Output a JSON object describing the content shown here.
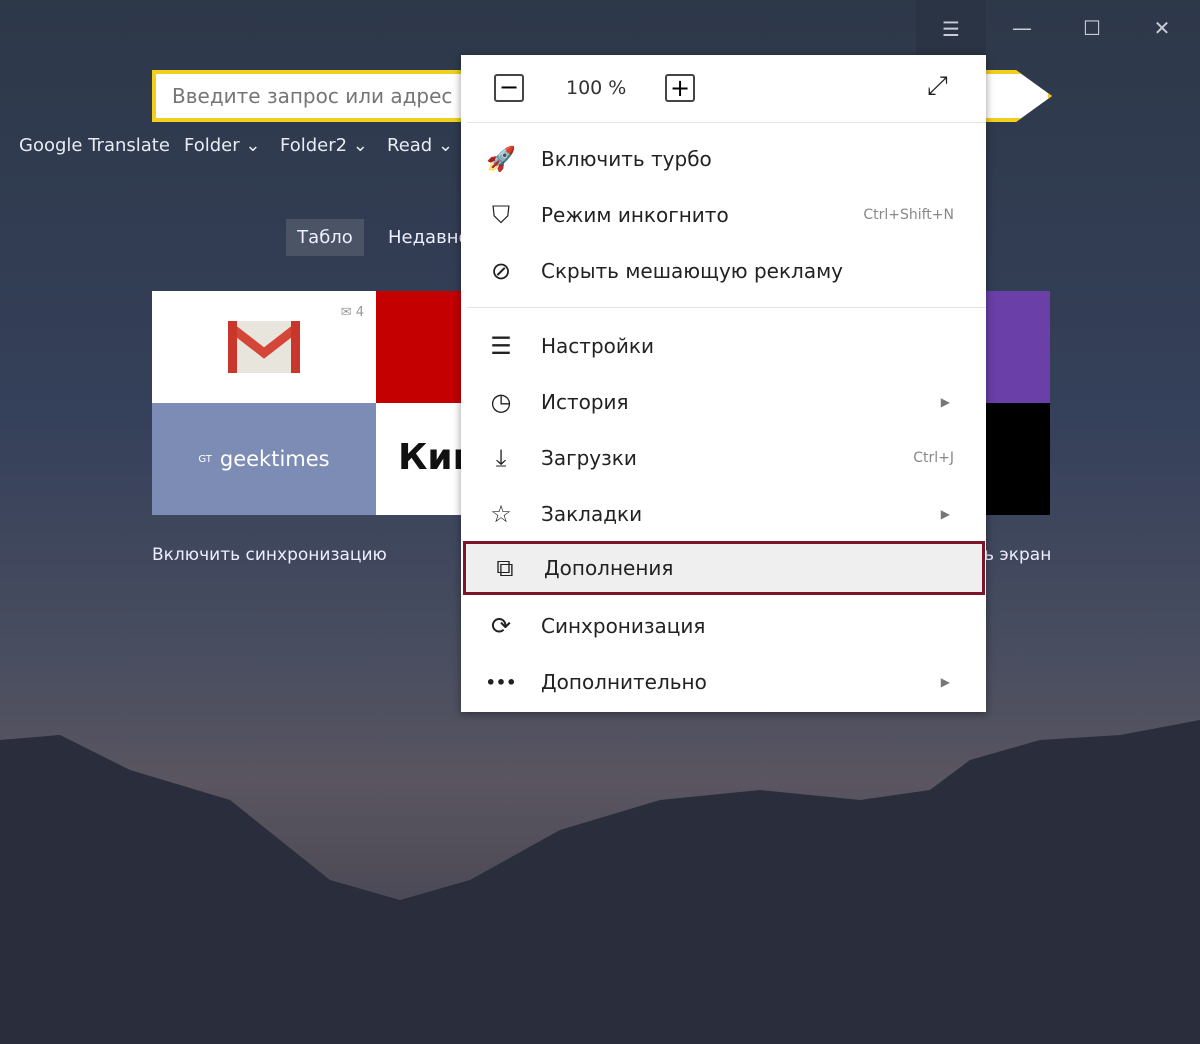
{
  "window": {
    "menu_icon": "hamburger-icon",
    "minimize": "—",
    "maximize": "☐",
    "close": "✕"
  },
  "search": {
    "placeholder": "Введите запрос или адрес",
    "value": ""
  },
  "bookmarks": [
    {
      "label": "Google Translate"
    },
    {
      "label": "Folder ⌄"
    },
    {
      "label": "Folder2 ⌄"
    },
    {
      "label": "Read ⌄"
    }
  ],
  "tabs": {
    "active": "Табло",
    "other": "Недавно"
  },
  "tiles": {
    "gmail_badge": "✉ 4",
    "geektimes_logo": "GT",
    "geektimes": "geektimes",
    "kino": "Кин"
  },
  "links": {
    "sync": "Включить синхронизацию",
    "screen": "ь экран"
  },
  "menu": {
    "zoom": {
      "minus": "−",
      "value": "100 %",
      "plus": "+",
      "fullscreen": "⤢"
    },
    "items": [
      {
        "label": "Включить турбо",
        "icon": "rocket-icon",
        "shortcut": ""
      },
      {
        "label": "Режим инкогнито",
        "icon": "mask-icon",
        "shortcut": "Ctrl+Shift+N"
      },
      {
        "label": "Скрыть мешающую рекламу",
        "icon": "block-icon",
        "shortcut": ""
      },
      {
        "label": "Настройки",
        "icon": "sliders-icon",
        "shortcut": ""
      },
      {
        "label": "История",
        "icon": "clock-icon",
        "shortcut": "",
        "submenu": "▶"
      },
      {
        "label": "Загрузки",
        "icon": "download-icon",
        "shortcut": "Ctrl+J"
      },
      {
        "label": "Закладки",
        "icon": "star-icon",
        "shortcut": "",
        "submenu": "▶"
      },
      {
        "label": "Дополнения",
        "icon": "addons-icon",
        "shortcut": "",
        "highlighted": true
      },
      {
        "label": "Синхронизация",
        "icon": "sync-icon",
        "shortcut": ""
      },
      {
        "label": "Дополнительно",
        "icon": "more-icon",
        "shortcut": "",
        "submenu": "▶"
      }
    ],
    "glyphs": [
      "🚀",
      "⛉",
      "⊘",
      "☰",
      "◷",
      "⤓",
      "☆",
      "⧉",
      "⟳",
      "•••"
    ]
  },
  "colors": {
    "search_border": "#f2cf1e",
    "highlight_border": "#7b1628",
    "red_tile": "#c40000",
    "purple_tile": "#6a3fa8",
    "geektimes_tile": "#7d8cb5"
  }
}
